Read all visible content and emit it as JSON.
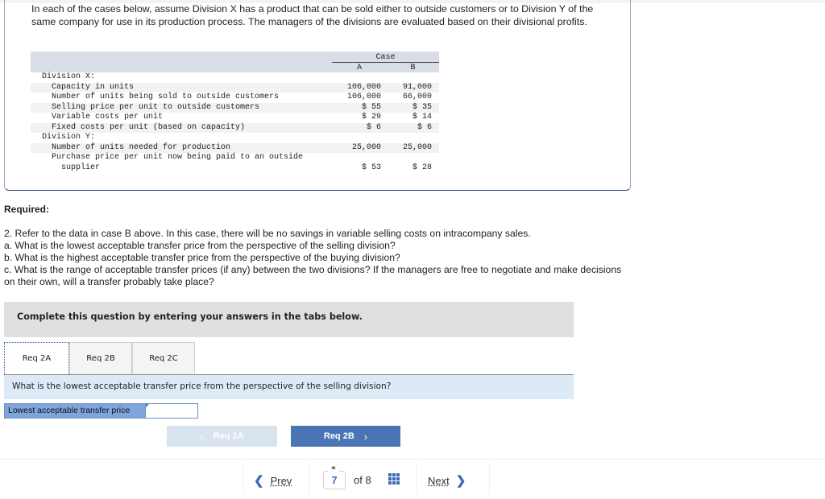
{
  "problem": {
    "intro": "In each of the cases below, assume Division X has a product that can be sold either to outside customers or to Division Y of the same company for use in its production process. The managers of the divisions are evaluated based on their divisional profits.",
    "table": {
      "group_header": "Case",
      "columns": [
        "A",
        "B"
      ],
      "rows": [
        {
          "label": "Division X:",
          "level": 0,
          "a": "",
          "b": ""
        },
        {
          "label": "Capacity in units",
          "level": 1,
          "a": "106,000",
          "b": "91,000"
        },
        {
          "label": "Number of units being sold to outside customers",
          "level": 1,
          "a": "106,000",
          "b": "66,000"
        },
        {
          "label": "Selling price per unit to outside customers",
          "level": 1,
          "a": "$ 55",
          "b": "$ 35"
        },
        {
          "label": "Variable costs per unit",
          "level": 1,
          "a": "$ 29",
          "b": "$ 14"
        },
        {
          "label": "Fixed costs per unit (based on capacity)",
          "level": 1,
          "a": "$ 6",
          "b": "$ 6"
        },
        {
          "label": "Division Y:",
          "level": 0,
          "a": "",
          "b": ""
        },
        {
          "label": "Number of units needed for production",
          "level": 1,
          "a": "25,000",
          "b": "25,000"
        },
        {
          "label": "Purchase price per unit now being paid to an outside",
          "label_cont": "supplier",
          "level": 1,
          "a": "$ 53",
          "b": "$ 28"
        }
      ]
    }
  },
  "required": {
    "title": "Required:",
    "lines": [
      "2. Refer to the data in case B above. In this case, there will be no savings in variable selling costs on intracompany sales.",
      "a. What is the lowest acceptable transfer price from the perspective of the selling division?",
      "b. What is the highest acceptable transfer price from the perspective of the buying division?",
      "c. What is the range of acceptable transfer prices (if any) between the two divisions? If the managers are free to negotiate and make decisions on their own, will a transfer probably take place?"
    ]
  },
  "instructions": "Complete this question by entering your answers in the tabs below.",
  "tabs": [
    {
      "label": "Req 2A",
      "active": true
    },
    {
      "label": "Req 2B",
      "active": false
    },
    {
      "label": "Req 2C",
      "active": false
    }
  ],
  "active_question": "What is the lowest acceptable transfer price from the perspective of the selling division?",
  "answer": {
    "label": "Lowest acceptable transfer price",
    "value": ""
  },
  "tab_nav": {
    "prev_label": "Req 2A",
    "next_label": "Req 2B",
    "prev_icon": "chevron-left-icon",
    "next_icon": "chevron-right-icon"
  },
  "pager": {
    "prev_label": "Prev",
    "next_label": "Next",
    "current_page": "7",
    "of_text": "of 8",
    "link_icon": "link-icon",
    "grid_icon": "grid-icon"
  },
  "colors": {
    "primary_blue": "#4a74b4",
    "disabled_blue": "#d8e3f0",
    "answer_label_bg": "#7fa6dc",
    "question_bar_bg": "#dde9f7",
    "instruction_bg": "#e0e0e0",
    "table_header_bg": "#d9dde6"
  }
}
